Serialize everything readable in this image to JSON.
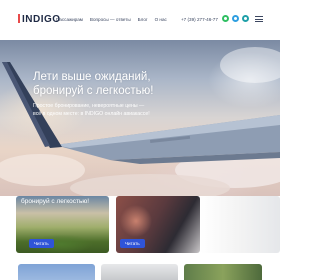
{
  "header": {
    "logo": "INDIGO",
    "nav": [
      "Пассажирам",
      "Вопросы — ответы",
      "Блог",
      "О нас"
    ],
    "nav_second_row": "Контакты",
    "phone": "+7 (39) 277-46-77",
    "messenger_icons": [
      "whatsapp-icon",
      "telegram-icon",
      "viber-icon"
    ],
    "menu_icon": "burger-menu-icon"
  },
  "hero": {
    "title_line1": "Лети выше ожиданий,",
    "title_line2": "бронируй с легкостью!",
    "subtitle_line1": "Простое бронирование, невероятные цены —",
    "subtitle_line2": "всё в одном месте: в INDIGO онлайн авиакассе!"
  },
  "cards": [
    {
      "title": "бронируй с легкостью!",
      "button": "Читать"
    },
    {
      "button": "Читать"
    }
  ],
  "colors": {
    "accent_button": "#2f54d8",
    "logo_mark": "#e84a4a",
    "whatsapp": "#2fbf62",
    "telegram": "#2e9fe0",
    "viber": "#1fa0a8"
  }
}
